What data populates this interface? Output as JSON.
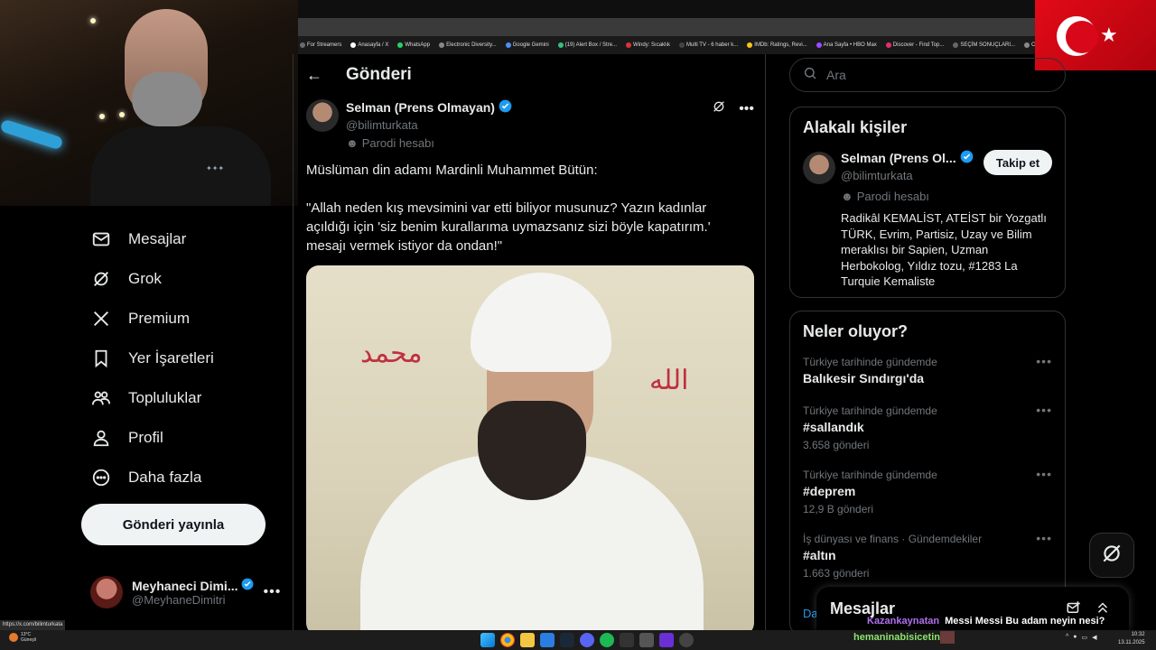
{
  "bookmarks": [
    {
      "label": "For Streamers",
      "color": "#6a6a6a"
    },
    {
      "label": "Anasayfa / X",
      "color": "#ffffff"
    },
    {
      "label": "WhatsApp",
      "color": "#25d366"
    },
    {
      "label": "Electronic Diversity...",
      "color": "#888888"
    },
    {
      "label": "Google Gemini",
      "color": "#4f8df5"
    },
    {
      "label": "(19) Alert Box / Stre...",
      "color": "#31c27c"
    },
    {
      "label": "Windy: Sıcaklık",
      "color": "#d33"
    },
    {
      "label": "Multi TV - 6 haber k...",
      "color": "#444"
    },
    {
      "label": "IMDb: Ratings, Revi...",
      "color": "#f5c518"
    },
    {
      "label": "Ana Sayfa • HBO Max",
      "color": "#9b4dff"
    },
    {
      "label": "Discover - Find Top...",
      "color": "#e1306c"
    },
    {
      "label": "SEÇİM SONUÇLARI...",
      "color": "#666"
    },
    {
      "label": "Ch",
      "color": "#888"
    }
  ],
  "sidebar": {
    "items": [
      {
        "label": "Mesajlar",
        "icon": "mail-icon"
      },
      {
        "label": "Grok",
        "icon": "grok-icon"
      },
      {
        "label": "Premium",
        "icon": "x-logo-icon"
      },
      {
        "label": "Yer İşaretleri",
        "icon": "bookmark-icon"
      },
      {
        "label": "Topluluklar",
        "icon": "communities-icon"
      },
      {
        "label": "Profil",
        "icon": "profile-icon"
      },
      {
        "label": "Daha fazla",
        "icon": "more-circle-icon"
      }
    ],
    "post_button": "Gönderi yayınla",
    "account": {
      "name": "Meyhaneci Dimi...",
      "handle": "@MeyhaneDimitri",
      "more": "•••"
    }
  },
  "post": {
    "header_title": "Gönderi",
    "author_name": "Selman (Prens Olmayan)",
    "author_handle": "@bilimturkata",
    "parody_label": "Parodi hesabı",
    "more": "•••",
    "text": "Müslüman din adamı Mardinli Muhammet Bütün:\n\n\"Allah neden kış mevsimini var etti biliyor musunuz? Yazın kadınlar açıldığı için 'siz benim kurallarıma uymazsanız sizi böyle kapatırım.' mesajı vermek istiyor da ondan!\""
  },
  "right": {
    "search_placeholder": "Ara",
    "related_title": "Alakalı kişiler",
    "related": {
      "name": "Selman (Prens Ol...",
      "handle": "@bilimturkata",
      "parody": "Parodi hesabı",
      "follow": "Takip et",
      "bio": "Radikâl KEMALİST, ATEİST bir Yozgatlı TÜRK, Evrim, Partisiz, Uzay ve Bilim meraklısı bir Sapien, Uzman Herbokolog, Yıldız tozu, #1283 La Turquie Kemaliste"
    },
    "trends_title": "Neler oluyor?",
    "trends": [
      {
        "category": "Türkiye tarihinde gündemde",
        "name": "Balıkesir Sındırgı'da",
        "count": ""
      },
      {
        "category": "Türkiye tarihinde gündemde",
        "name": "#sallandık",
        "count": "3.658 gönderi"
      },
      {
        "category": "Türkiye tarihinde gündemde",
        "name": "#deprem",
        "count": "12,9 B gönderi"
      },
      {
        "category": "İş dünyası ve finans · Gündemdekiler",
        "name": "#altın",
        "count": "1.663 gönderi"
      }
    ],
    "trend_more": "•••",
    "da_link": "Da",
    "messages_drawer": "Mesajlar"
  },
  "chat": {
    "user1": "Kazankaynatan",
    "msg1": "Messi Messi Bu adam neyin nesi?",
    "user2": "hemaninabisicetin"
  },
  "status_url": "https://x.com/bilimturkata",
  "taskbar": {
    "weather_temp": "13°C",
    "weather_desc": "Güneşli",
    "time": "10:32",
    "date": "13.11.2025"
  }
}
